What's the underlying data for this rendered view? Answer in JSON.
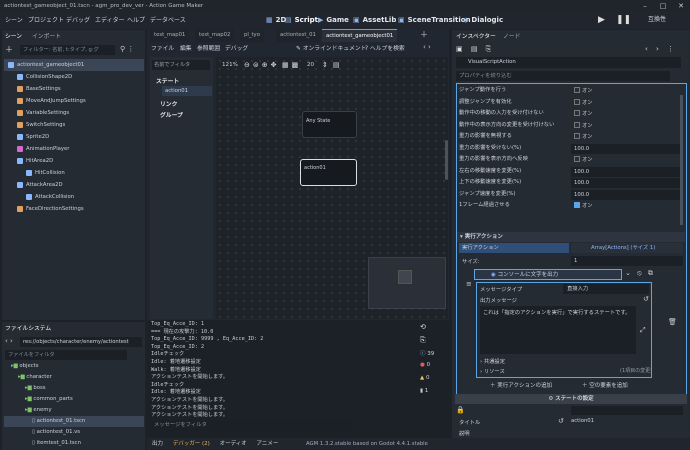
{
  "window": {
    "title": "actiontest_gameobject_01.tscn - agm_pro_dev_ver - Action Game Maker"
  },
  "menus": [
    "シーン",
    "プロジェクト",
    "デバッグ",
    "エディター",
    "ヘルプ",
    "データベース"
  ],
  "workspaces": [
    {
      "label": "2D",
      "icon": "2d-icon"
    },
    {
      "label": "Script",
      "icon": "script-icon"
    },
    {
      "label": "Game",
      "icon": "game-icon"
    },
    {
      "label": "AssetLib",
      "icon": "assetlib-icon"
    },
    {
      "label": "SceneTransition",
      "icon": "scene-transition-icon"
    },
    {
      "label": "Dialogic",
      "icon": "dialogic-icon"
    }
  ],
  "right_mode": "互換性",
  "scene_panel": {
    "tabs": [
      "シーン",
      "インポート"
    ],
    "filter_placeholder": "フィルター: 名前, t:タイプ, g:グ",
    "nodes": [
      {
        "label": "actiontest_gameobject01",
        "color": "#8ab8ff",
        "indent": 0
      },
      {
        "label": "CollisionShape2D",
        "color": "#8ab8ff",
        "indent": 1
      },
      {
        "label": "BaseSettings",
        "color": "#e0a060",
        "indent": 1
      },
      {
        "label": "MoveAndJumpSettings",
        "color": "#e0a060",
        "indent": 1
      },
      {
        "label": "VariableSettings",
        "color": "#e0a060",
        "indent": 1
      },
      {
        "label": "SwitchSettings",
        "color": "#e0a060",
        "indent": 1
      },
      {
        "label": "Sprite2D",
        "color": "#8ab8ff",
        "indent": 1
      },
      {
        "label": "AnimationPlayer",
        "color": "#d06ad0",
        "indent": 1
      },
      {
        "label": "HitArea2D",
        "color": "#8ab8ff",
        "indent": 1
      },
      {
        "label": "HitCollision",
        "color": "#8ab8ff",
        "indent": 2
      },
      {
        "label": "AttackArea2D",
        "color": "#8ab8ff",
        "indent": 1
      },
      {
        "label": "AttackCollision",
        "color": "#8ab8ff",
        "indent": 2
      },
      {
        "label": "FaceDirectionSettings",
        "color": "#e0a060",
        "indent": 1
      }
    ]
  },
  "filesystem": {
    "title": "ファイルシステム",
    "path": "res://objects/character/enemy/actiontest",
    "filter_placeholder": "ファイルをフィルタ",
    "items": [
      {
        "label": "objects",
        "indent": 1,
        "type": "folder"
      },
      {
        "label": "character",
        "indent": 2,
        "type": "folder"
      },
      {
        "label": "boss",
        "indent": 3,
        "type": "folder"
      },
      {
        "label": "common_parts",
        "indent": 3,
        "type": "folder"
      },
      {
        "label": "enemy",
        "indent": 3,
        "type": "folder"
      },
      {
        "label": "actiontest_01.tscn",
        "indent": 4,
        "type": "file"
      },
      {
        "label": "actiontest_01.vs",
        "indent": 4,
        "type": "file"
      },
      {
        "label": "itemtest_01.tscn",
        "indent": 4,
        "type": "file"
      }
    ]
  },
  "editor_tabs": [
    "test_map01",
    "test_map02",
    "pl_tyo",
    "actiontest_01",
    "actiontest_gameobject01"
  ],
  "script_toolbar": {
    "items": [
      "ファイル",
      "編集",
      "参照範囲",
      "デバッグ"
    ],
    "online_doc": "オンラインドキュメント",
    "help_search": "ヘルプを検索"
  },
  "state_list": {
    "filter": "名前でフィルタ",
    "state_header": "ステート",
    "state_item": "action01",
    "links": "リンク",
    "groups": "グループ"
  },
  "graph": {
    "zoom": "121%",
    "snap": "20",
    "nodes": [
      {
        "label": "Any State"
      },
      {
        "label": "action01"
      }
    ]
  },
  "output": {
    "lines": [
      "Top_Eq_Acce_ID: 1",
      "=== 現在の攻撃力: 10.0",
      "Top_Eq_Acce_ID: 9999 , Eq_Acce_ID: 2",
      "Top_Eq_Acce_ID: 2",
      "Idleチェック",
      "Idle: 着地遷移設定",
      "Walk: 着地遷移設定",
      "アクションテストを開始します。",
      "Idleチェック",
      "Idle: 着地遷移設定",
      "アクションテストを開始します。",
      "アクションテストを開始します。",
      "アクションテストを開始します。"
    ],
    "filter_placeholder": "メッセージをフィルタ",
    "counts": [
      "39",
      "0",
      "0",
      "1"
    ]
  },
  "bottom_tabs": [
    "出力",
    "デバッガー (2)",
    "オーディオ",
    "アニメー"
  ],
  "version": "AGM 1.3.2.stable based on Godot 4.4.1.stable",
  "inspector": {
    "tabs": [
      "インスペクター",
      "ノード"
    ],
    "node": "VisualScriptAction",
    "filter": "プロパティを絞り込む",
    "props": [
      {
        "label": "ジャンプ動作を行う",
        "value": "オン",
        "type": "check"
      },
      {
        "label": "調整ジャンプを有効化",
        "value": "オン",
        "type": "check"
      },
      {
        "label": "動作中の移動の入力を受け付けない",
        "value": "オン",
        "type": "check"
      },
      {
        "label": "動作中の表示方向の変更を受け付けない",
        "value": "オン",
        "type": "check"
      },
      {
        "label": "重力の影響を無視する",
        "value": "オン",
        "type": "check"
      },
      {
        "label": "重力の影響を受けない(%)",
        "value": "100.0",
        "type": "num"
      },
      {
        "label": "重力の影響を表示方向へ反映",
        "value": "オン",
        "type": "check"
      },
      {
        "label": "左右の移動速度を変更(%)",
        "value": "100.0",
        "type": "num"
      },
      {
        "label": "上下の移動速度を変更(%)",
        "value": "100.0",
        "type": "num"
      },
      {
        "label": "ジャンプ速度を変更(%)",
        "value": "100.0",
        "type": "num"
      },
      {
        "label": "1フレーム経過させる",
        "value": "オン",
        "type": "check"
      }
    ],
    "section_exec": "実行アクション",
    "exec_label": "実行アクション",
    "exec_value": "Array[Actions] (サイズ 1)",
    "size_label": "サイズ:",
    "size_value": "1",
    "action_item": "コンソールに文字を出力",
    "msg_type_label": "メッセージタイプ",
    "msg_type_value": "直接入力",
    "out_msg_label": "出力メッセージ",
    "out_msg_text": "これは「指定のアクションを実行」で実行するステートです。",
    "shared": "共通設定",
    "resource": "リソース",
    "resource_count": "(1項目の変更)",
    "add_action": "実行アクションの追加",
    "add_var": "空の要素を追加",
    "state_settings": "ステートの設定",
    "title_label": "タイトル",
    "title_value": "action01",
    "desc_label": "説明"
  }
}
